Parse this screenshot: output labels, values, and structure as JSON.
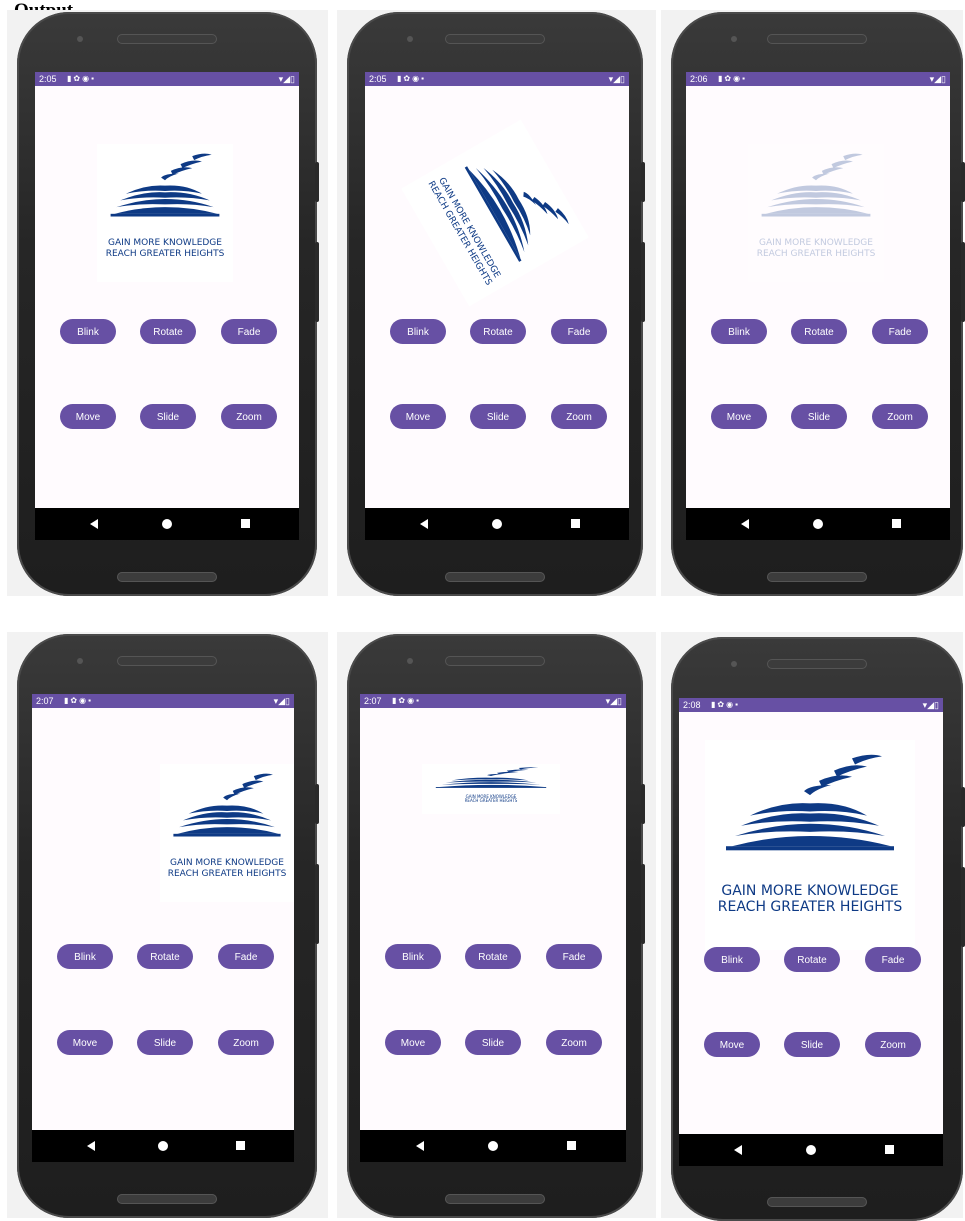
{
  "heading": "Output",
  "accent_color": "#6750a4",
  "screens": [
    {
      "time": "2:05",
      "animation_state": "blink",
      "logo": {
        "line1": "GAIN MORE KNOWLEDGE",
        "line2": "REACH GREATER HEIGHTS"
      }
    },
    {
      "time": "2:05",
      "animation_state": "rotate",
      "logo": {
        "line1": "GAIN MORE KNOWLEDGE",
        "line2": "REACH GREATER HEIGHTS"
      }
    },
    {
      "time": "2:06",
      "animation_state": "fade",
      "logo": {
        "line1": "GAIN MORE KNOWLEDGE",
        "line2": "REACH GREATER HEIGHTS"
      }
    },
    {
      "time": "2:07",
      "animation_state": "move",
      "logo": {
        "line1": "GAIN MORE KNOWLEDGE",
        "line2": "REACH GREATER HEIGHTS"
      }
    },
    {
      "time": "2:07",
      "animation_state": "slide",
      "logo": {
        "line1": "GAIN MORE KNOWLEDGE",
        "line2": "REACH GREATER HEIGHTS"
      }
    },
    {
      "time": "2:08",
      "animation_state": "zoom",
      "logo": {
        "line1": "GAIN MORE KNOWLEDGE",
        "line2": "REACH GREATER HEIGHTS"
      }
    }
  ],
  "buttons": {
    "blink": "Blink",
    "rotate": "Rotate",
    "fade": "Fade",
    "move": "Move",
    "slide": "Slide",
    "zoom": "Zoom"
  },
  "status_icons": [
    "sim-icon",
    "gear-icon",
    "sync-icon",
    "sd-card-icon"
  ],
  "status_right_icons": [
    "wifi-icon",
    "signal-icon",
    "battery-icon"
  ],
  "nav_icons": [
    "back-icon",
    "home-icon",
    "recent-apps-icon"
  ]
}
